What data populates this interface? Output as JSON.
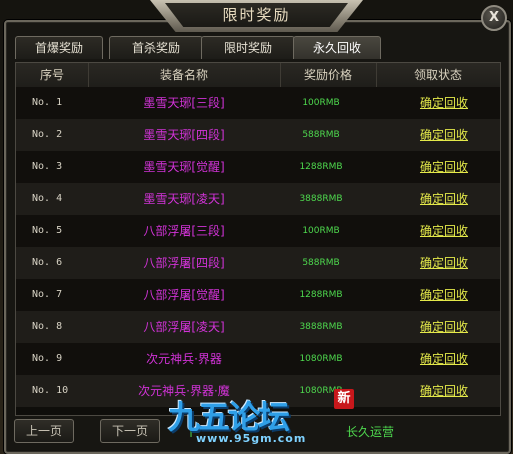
{
  "window": {
    "title": "限时奖励",
    "close_label": "X"
  },
  "tabs": [
    {
      "label": "首爆奖励",
      "active": false
    },
    {
      "label": "首杀奖励",
      "active": false
    },
    {
      "label": "限时奖励",
      "active": false
    },
    {
      "label": "永久回收",
      "active": true
    }
  ],
  "table": {
    "headers": [
      "序号",
      "装备名称",
      "奖励价格",
      "领取状态"
    ],
    "rows": [
      {
        "no": "No.  1",
        "name": "墨雪天琊[三段]",
        "price": "100RMB",
        "action": "确定回收"
      },
      {
        "no": "No.  2",
        "name": "墨雪天琊[四段]",
        "price": "588RMB",
        "action": "确定回收"
      },
      {
        "no": "No.  3",
        "name": "墨雪天琊[觉醒]",
        "price": "1288RMB",
        "action": "确定回收"
      },
      {
        "no": "No.  4",
        "name": "墨雪天琊[凌天]",
        "price": "3888RMB",
        "action": "确定回收"
      },
      {
        "no": "No.  5",
        "name": "八部浮屠[三段]",
        "price": "100RMB",
        "action": "确定回收"
      },
      {
        "no": "No.  6",
        "name": "八部浮屠[四段]",
        "price": "588RMB",
        "action": "确定回收"
      },
      {
        "no": "No.  7",
        "name": "八部浮屠[觉醒]",
        "price": "1288RMB",
        "action": "确定回收"
      },
      {
        "no": "No.  8",
        "name": "八部浮屠[凌天]",
        "price": "3888RMB",
        "action": "确定回收"
      },
      {
        "no": "No.  9",
        "name": "次元神兵·界器",
        "price": "1080RMB",
        "action": "确定回收"
      },
      {
        "no": "No. 10",
        "name": "次元神兵·界器·魔",
        "price": "1080RMB",
        "action": "确定回收"
      }
    ]
  },
  "footer": {
    "prev_label": "上一页",
    "next_label": "下一页",
    "green_fragment": "|",
    "slogan": "长久运营"
  },
  "watermark": {
    "text": "九五论坛",
    "url": "www.95gm.com",
    "seal": "新"
  },
  "colors": {
    "item_name": "#d233d8",
    "price": "#4ed84e",
    "action": "#e4e94a"
  }
}
